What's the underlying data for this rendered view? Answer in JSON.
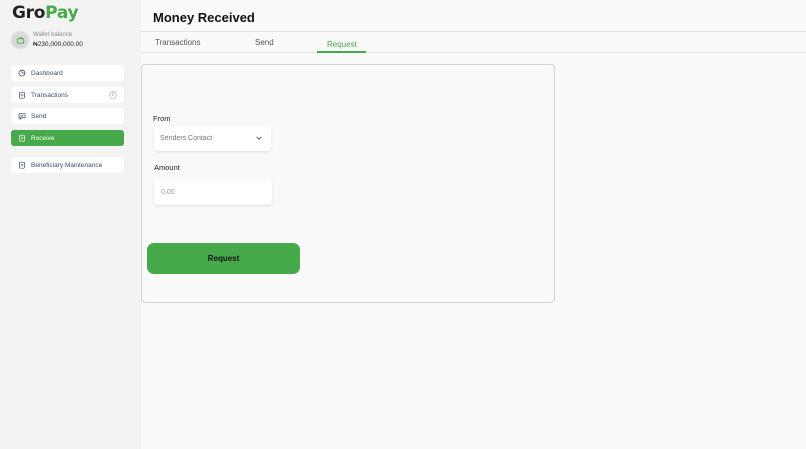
{
  "brand": {
    "part1": "Gro",
    "part2": "Pay"
  },
  "wallet": {
    "label": "Wallet balance",
    "value": "₦230,000,000.00",
    "icon": "wallet-icon"
  },
  "sidebar": {
    "items": [
      {
        "label": "Dashboard",
        "icon": "dashboard-icon",
        "active": false
      },
      {
        "label": "Transactions",
        "icon": "transactions-icon",
        "active": false,
        "badge": "0"
      },
      {
        "label": "Send",
        "icon": "send-icon",
        "active": false
      },
      {
        "label": "Receive",
        "icon": "receive-icon",
        "active": true
      },
      {
        "label": "Beneficiary Maintenance",
        "icon": "beneficiary-icon",
        "active": false
      }
    ]
  },
  "header": {
    "title": "Money Received"
  },
  "tabs": [
    {
      "label": "Transactions",
      "active": false
    },
    {
      "label": "Send",
      "active": false
    },
    {
      "label": "Request",
      "active": true
    }
  ],
  "form": {
    "from_label": "From",
    "from_value": "Senders Contact",
    "amount_label": "Amount",
    "amount_placeholder": "0.00",
    "submit_label": "Request"
  },
  "colors": {
    "accent": "#46a94a",
    "sidebar_bg": "#f3f3f3",
    "page_bg": "#f9f9f9"
  }
}
